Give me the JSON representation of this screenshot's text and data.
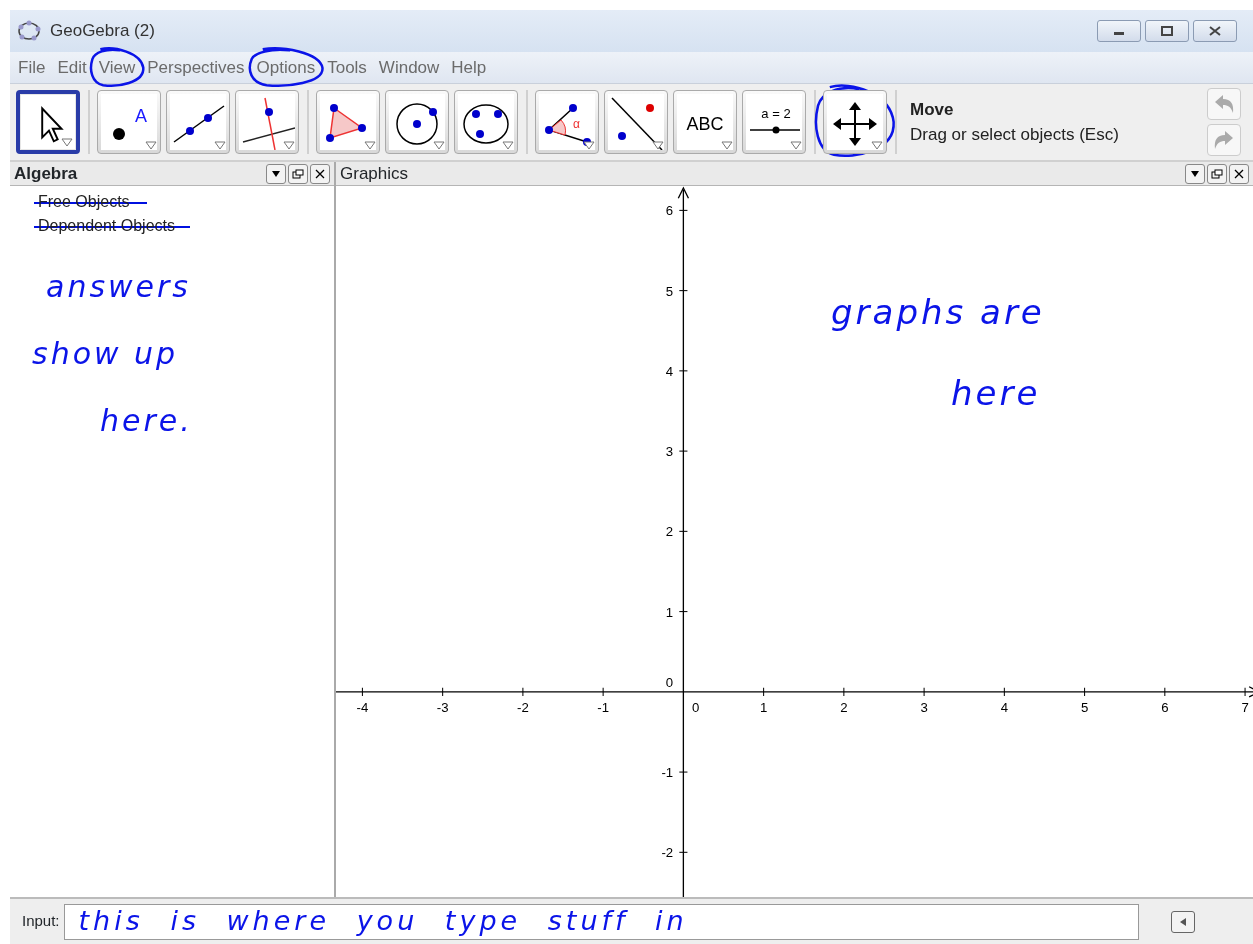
{
  "window": {
    "title": "GeoGebra (2)"
  },
  "menu": [
    {
      "label": "File",
      "circled": false
    },
    {
      "label": "Edit",
      "circled": false
    },
    {
      "label": "View",
      "circled": true
    },
    {
      "label": "Perspectives",
      "circled": false
    },
    {
      "label": "Options",
      "circled": true
    },
    {
      "label": "Tools",
      "circled": false
    },
    {
      "label": "Window",
      "circled": false
    },
    {
      "label": "Help",
      "circled": false
    }
  ],
  "toolbar": {
    "groups": [
      [
        {
          "kind": "move",
          "selected": true,
          "circled": false
        }
      ],
      [
        {
          "kind": "point",
          "label": "A",
          "selected": false,
          "circled": false
        },
        {
          "kind": "line",
          "selected": false,
          "circled": false
        },
        {
          "kind": "perpendicular",
          "selected": false,
          "circled": false
        }
      ],
      [
        {
          "kind": "polygon",
          "selected": false,
          "circled": false
        },
        {
          "kind": "circle",
          "selected": false,
          "circled": false
        },
        {
          "kind": "conic",
          "selected": false,
          "circled": false
        }
      ],
      [
        {
          "kind": "angle",
          "label": "α",
          "selected": false,
          "circled": false
        },
        {
          "kind": "reflect",
          "selected": false,
          "circled": false
        },
        {
          "kind": "text",
          "label": "ABC",
          "selected": false,
          "circled": false
        },
        {
          "kind": "slider",
          "label": "a = 2",
          "selected": false,
          "circled": false
        }
      ],
      [
        {
          "kind": "pan",
          "selected": false,
          "circled": true
        }
      ]
    ],
    "tool_name": "Move",
    "tool_help": "Drag or select objects (Esc)"
  },
  "algebra": {
    "title": "Algebra",
    "items": [
      {
        "label": "Free Objects",
        "struck": true
      },
      {
        "label": "Dependent Objects",
        "struck": true
      }
    ],
    "notes": [
      "answers",
      "show up",
      "here."
    ]
  },
  "graphics": {
    "title": "Graphics",
    "x_ticks": [
      "-4",
      "-3",
      "-2",
      "-1",
      "0",
      "1",
      "2",
      "3",
      "4",
      "5",
      "6",
      "7"
    ],
    "y_ticks": [
      "6",
      "5",
      "4",
      "3",
      "2",
      "1",
      "0",
      "-1",
      "-2"
    ],
    "notes": [
      "graphs are",
      "here"
    ]
  },
  "input": {
    "label": "Input:",
    "value": "this is where you type stuff in"
  }
}
